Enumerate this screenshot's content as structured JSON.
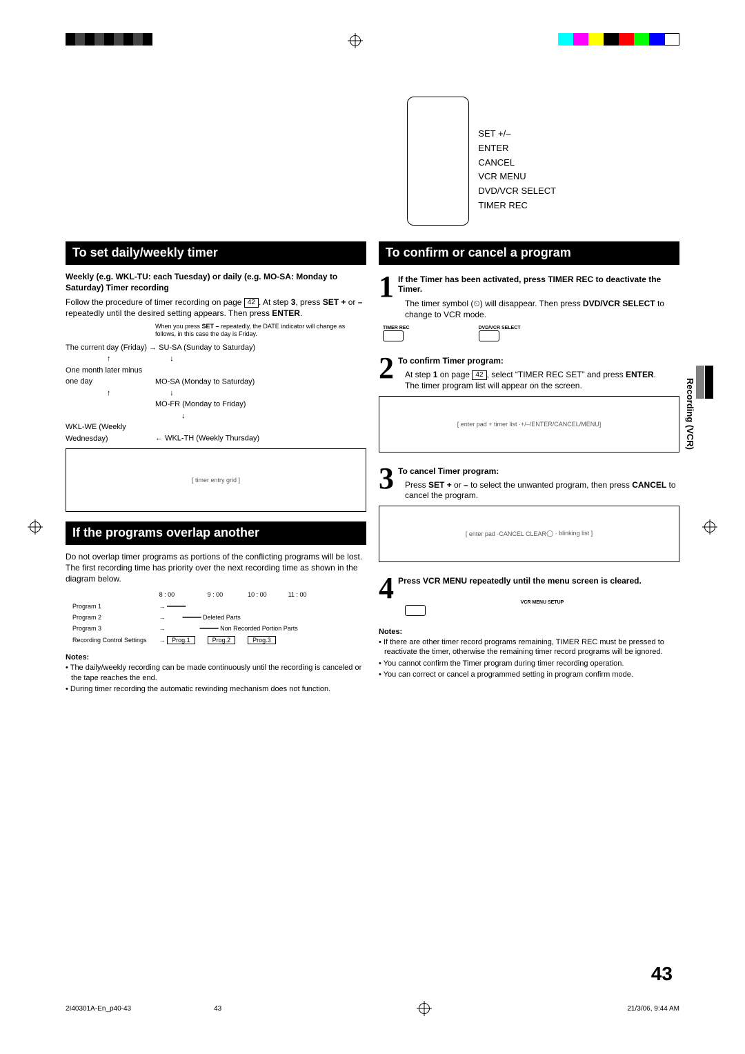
{
  "meta": {
    "footer_file": "2I40301A-En_p40-43",
    "footer_page": "43",
    "footer_date": "21/3/06, 9:44 AM",
    "page_number": "43",
    "side_section": "Recording (VCR)"
  },
  "remote_labels": [
    "SET +/–",
    "ENTER",
    "CANCEL",
    "VCR MENU",
    "DVD/VCR SELECT",
    "TIMER REC"
  ],
  "left": {
    "h1": "To set daily/weekly timer",
    "intro_bold": "Weekly (e.g. WKL-TU: each Tuesday) or daily (e.g. MO-SA: Monday to Saturday) Timer recording",
    "intro_1a": "Follow the procedure of timer recording on page ",
    "intro_page": "42",
    "intro_1b": ". At step ",
    "intro_step": "3",
    "intro_1c": ", press ",
    "intro_set": "SET +",
    "intro_or": " or ",
    "intro_minus": "–",
    "intro_1d": " repeatedly until the desired setting appears. Then press ",
    "intro_enter": "ENTER",
    "intro_end": ".",
    "flow_note_a": "When you press ",
    "flow_note_b": "SET –",
    "flow_note_c": " repeatedly, the DATE indicator will change as follows, in this case the day is Friday.",
    "flow": {
      "r1a": "The current day (Friday)",
      "r1b": "SU-SA (Sunday to Saturday)",
      "r2a": "One month later minus one day",
      "r2b": "MO-SA (Monday to Saturday)",
      "r3b": "MO-FR (Monday to Friday)",
      "r4a": "WKL-WE (Weekly Wednesday)",
      "r4b": "WKL-TH (Weekly Thursday)"
    },
    "h2": "If the programs overlap another",
    "overlap_text": "Do not overlap timer programs as portions of the conflicting programs will be lost. The first recording time has priority over the next recording time as shown in the diagram below.",
    "times": [
      "8 : 00",
      "9 : 00",
      "10 : 00",
      "11 : 00"
    ],
    "prog_rows": [
      "Program 1",
      "Program 2",
      "Program 3",
      "Recording Control Settings"
    ],
    "prog_cells": [
      "Prog.1",
      "Prog.2",
      "Prog.3"
    ],
    "diag_labels": {
      "deleted": "Deleted Parts",
      "nonrec": "Non Recorded Portion Parts"
    },
    "notes_hd": "Notes:",
    "notes": [
      "The daily/weekly recording can be made continuously until the recording is canceled or the tape reaches the end.",
      "During timer recording the automatic rewinding mechanism does not function."
    ]
  },
  "right": {
    "h1": "To confirm or cancel a program",
    "s1": {
      "num": "1",
      "bold": "If the Timer has been activated, press TIMER REC to deactivate the Timer.",
      "t1": "The timer symbol (",
      "t2": ") will disappear. Then press ",
      "t3": "DVD/VCR SELECT",
      "t4": " to change to VCR mode.",
      "lb1": "TIMER REC",
      "lb2": "DVD/VCR SELECT"
    },
    "s2": {
      "num": "2",
      "bold": "To confirm Timer program:",
      "t1": "At step ",
      "t1b": "1",
      "t2": " on page ",
      "pg": "42",
      "t3": ", select “TIMER REC SET” and press ",
      "t4": "ENTER",
      "t5": ".",
      "t6": "The timer program list will appear on the screen.",
      "screen_caption": "+/–/ENTER/CANCEL/MENU"
    },
    "s3": {
      "num": "3",
      "bold": "To cancel Timer program:",
      "t1": "Press ",
      "t2": "SET +",
      "t3": " or ",
      "t4": "–",
      "t5": " to select the unwanted program, then press ",
      "t6": "CANCEL",
      "t7": " to cancel the program.",
      "lbl": "CANCEL CLEAR"
    },
    "s4": {
      "num": "4",
      "bold": "Press VCR MENU repeatedly until the menu screen is cleared.",
      "lbl": "VCR MENU SETUP"
    },
    "notes_hd": "Notes:",
    "notes": [
      "If there are other timer record programs remaining, TIMER REC must be pressed to reactivate the timer, otherwise the remaining timer record programs will be ignored.",
      "You cannot confirm the Timer program during timer recording operation.",
      "You can correct or cancel a programmed setting in program confirm mode."
    ]
  }
}
